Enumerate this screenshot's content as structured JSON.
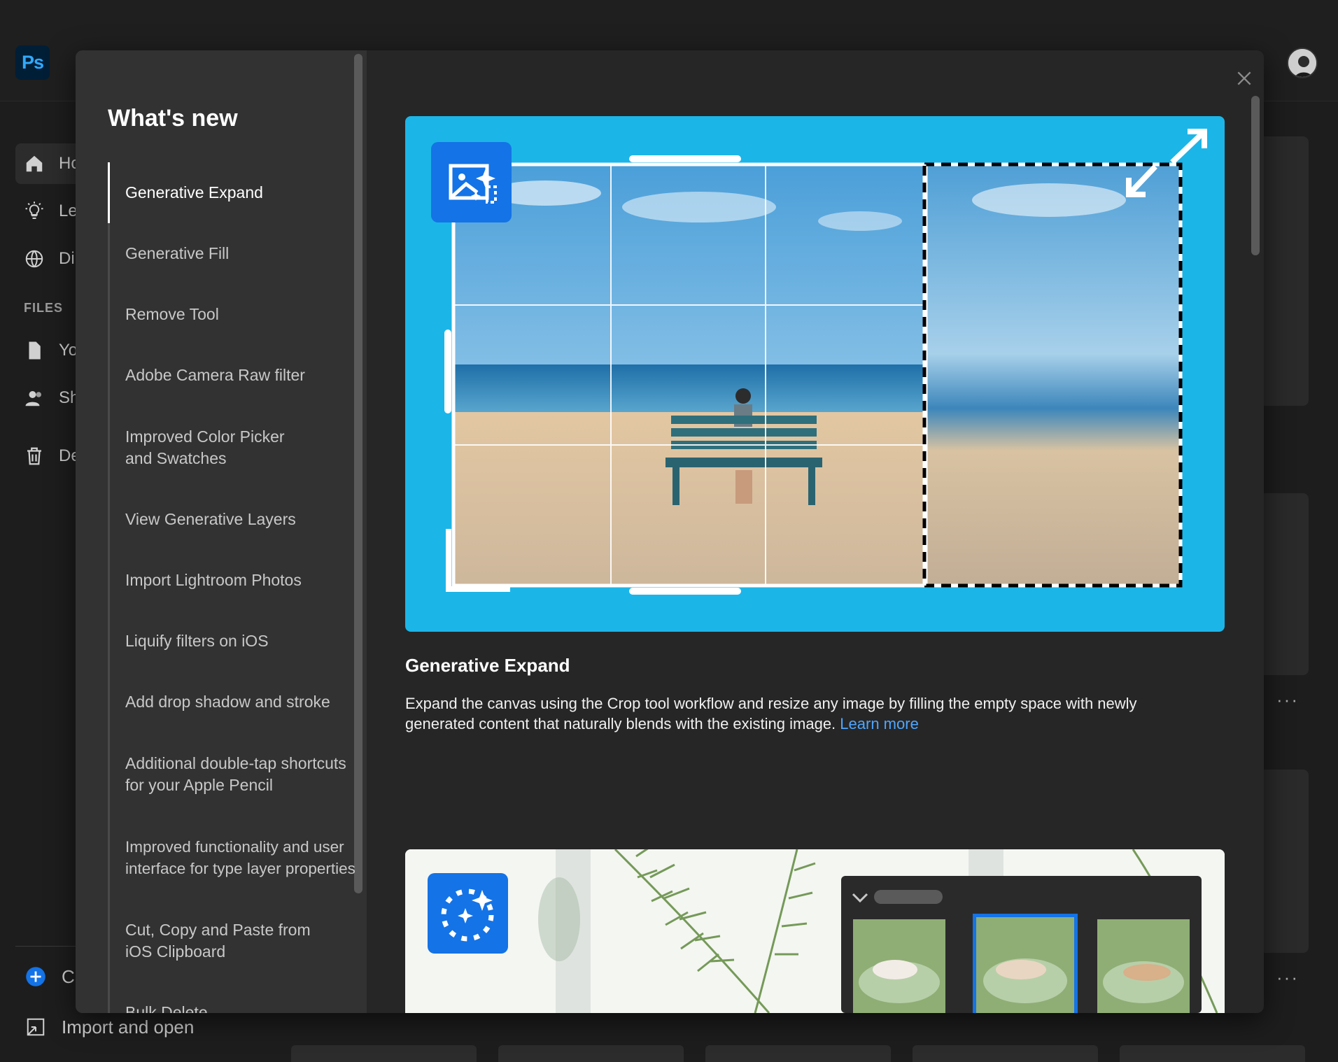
{
  "app": {
    "logo_text": "Ps"
  },
  "background_sidebar": {
    "items": [
      {
        "label": "Ho",
        "icon": "home-icon"
      },
      {
        "label": "Le",
        "icon": "lightbulb-icon"
      },
      {
        "label": "Di",
        "icon": "globe-icon"
      }
    ],
    "files_label": "FILES",
    "file_items": [
      {
        "label": "Yo",
        "icon": "file-icon"
      },
      {
        "label": "Sh",
        "icon": "people-icon"
      },
      {
        "label": "De",
        "icon": "trash-icon"
      }
    ],
    "create_label": "Cr",
    "import_label": "Import and open"
  },
  "modal": {
    "title": "What's new",
    "nav": [
      "Generative Expand",
      "Generative Fill",
      "Remove Tool",
      "Adobe Camera Raw filter",
      "Improved Color Picker and Swatches",
      "View Generative Layers",
      "Import Lightroom Photos",
      "Liquify filters on iOS",
      "Add drop shadow and stroke",
      "Additional double-tap shortcuts for your Apple Pencil",
      "Improved functionality and user interface for type layer properties",
      "Cut, Copy and Paste from iOS Clipboard",
      "Bulk Delete"
    ],
    "active_index": 0,
    "feature": {
      "title": "Generative Expand",
      "description": "Expand the canvas using the Crop tool workflow and resize any image by filling the empty space with newly generated content that naturally blends with the existing image.",
      "link": "Learn more"
    }
  },
  "colors": {
    "hero_bg": "#1cb5e8",
    "accent_blue": "#1473e6",
    "link": "#4ea6ff"
  }
}
